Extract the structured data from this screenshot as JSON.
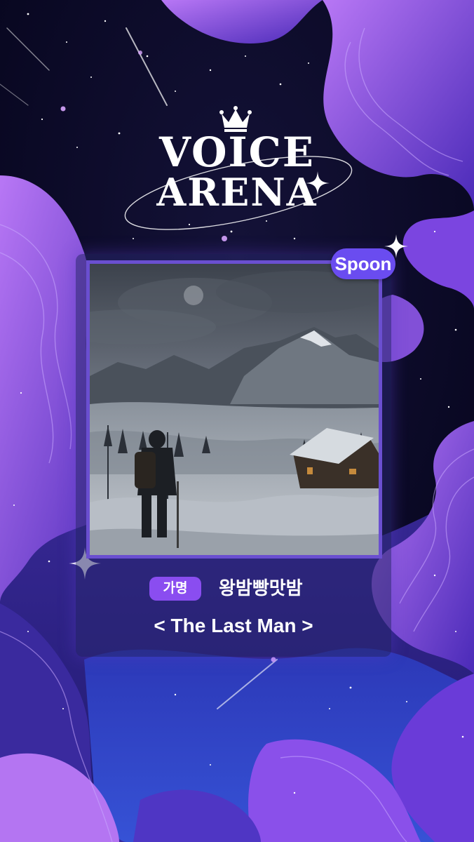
{
  "logo": {
    "line1": "VOICE",
    "line2": "ARENA"
  },
  "badge": {
    "label": "Spoon"
  },
  "entry": {
    "tag": "가명",
    "artist": "왕밤빵맛밤",
    "song_title": "< The Last Man >"
  },
  "colors": {
    "background": "#07061a",
    "cloud_purple": "#8f4fe8",
    "badge": "#6a4cf0",
    "tag": "#8a4df0"
  },
  "icons": [
    "crown-icon",
    "sparkle-icon"
  ]
}
